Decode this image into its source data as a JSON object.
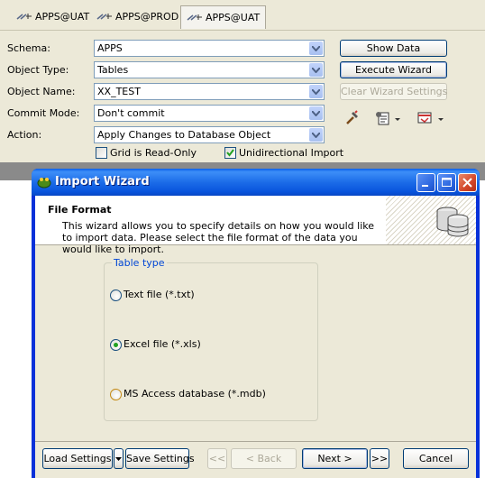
{
  "tabs": [
    {
      "label": "APPS@UAT"
    },
    {
      "label": "APPS@PROD"
    },
    {
      "label": "APPS@UAT"
    }
  ],
  "form": {
    "schema": {
      "label": "Schema:",
      "value": "APPS"
    },
    "object_type": {
      "label": "Object Type:",
      "value": "Tables"
    },
    "object_name": {
      "label": "Object Name:",
      "value": "XX_TEST"
    },
    "commit_mode": {
      "label": "Commit Mode:",
      "value": "Don't commit"
    },
    "action": {
      "label": "Action:",
      "value": "Apply Changes to Database Object"
    },
    "grid_read_only": {
      "label": "Grid is Read-Only",
      "checked": false
    },
    "unidirectional_import": {
      "label": "Unidirectional Import",
      "checked": true
    }
  },
  "buttons": {
    "show_data": "Show Data",
    "execute_wizard": "Execute Wizard",
    "clear_wizard_settings": "Clear Wizard Settings"
  },
  "toolbar_icons": [
    "hammer-icon",
    "properties-icon",
    "export-icon"
  ],
  "dialog": {
    "title": "Import Wizard",
    "section_title": "File Format",
    "description": "This wizard allows you to specify details on how you would like to import data. Please select the file format of the data you would like to import.",
    "group_title": "Table type",
    "options": [
      {
        "label": "Text file (*.txt)",
        "checked": false
      },
      {
        "label": "Excel file (*.xls)",
        "checked": true
      },
      {
        "label": "MS Access database (*.mdb)",
        "checked": false
      }
    ],
    "buttons": {
      "load_settings": "Load Settings",
      "save_settings": "Save Settings",
      "first": "<<",
      "back": "< Back",
      "next": "Next >",
      "last": ">>",
      "cancel": "Cancel"
    }
  },
  "colors": {
    "title_bar": "#0a5fe8",
    "group_title": "#0046d5",
    "radio_checked": "#21a121"
  }
}
